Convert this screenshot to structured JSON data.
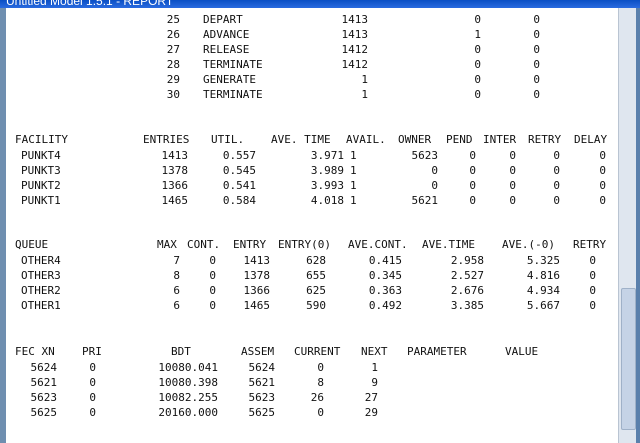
{
  "window": {
    "title": "Untitled Model 1.5.1 - REPORT"
  },
  "blocks": [
    {
      "no": "25",
      "type": "DEPART",
      "entry": "1413",
      "current": "0",
      "retry": "0"
    },
    {
      "no": "26",
      "type": "ADVANCE",
      "entry": "1413",
      "current": "1",
      "retry": "0"
    },
    {
      "no": "27",
      "type": "RELEASE",
      "entry": "1412",
      "current": "0",
      "retry": "0"
    },
    {
      "no": "28",
      "type": "TERMINATE",
      "entry": "1412",
      "current": "0",
      "retry": "0"
    },
    {
      "no": "29",
      "type": "GENERATE",
      "entry": "1",
      "current": "0",
      "retry": "0"
    },
    {
      "no": "30",
      "type": "TERMINATE",
      "entry": "1",
      "current": "0",
      "retry": "0"
    }
  ],
  "facility": {
    "headers": [
      "FACILITY",
      "ENTRIES",
      "UTIL.",
      "AVE. TIME",
      "AVAIL.",
      "OWNER",
      "PEND",
      "INTER",
      "RETRY",
      "DELAY"
    ],
    "rows": [
      [
        "PUNKT4",
        "1413",
        "0.557",
        "3.971",
        "1",
        "5623",
        "0",
        "0",
        "0",
        "0"
      ],
      [
        "PUNKT3",
        "1378",
        "0.545",
        "3.989",
        "1",
        "0",
        "0",
        "0",
        "0",
        "0"
      ],
      [
        "PUNKT2",
        "1366",
        "0.541",
        "3.993",
        "1",
        "0",
        "0",
        "0",
        "0",
        "0"
      ],
      [
        "PUNKT1",
        "1465",
        "0.584",
        "4.018",
        "1",
        "5621",
        "0",
        "0",
        "0",
        "0"
      ]
    ]
  },
  "queue": {
    "headers": [
      "QUEUE",
      "MAX",
      "CONT.",
      "ENTRY",
      "ENTRY(0)",
      "AVE.CONT.",
      "AVE.TIME",
      "AVE.(-0)",
      "RETRY"
    ],
    "rows": [
      [
        "OTHER4",
        "7",
        "0",
        "1413",
        "628",
        "0.415",
        "2.958",
        "5.325",
        "0"
      ],
      [
        "OTHER3",
        "8",
        "0",
        "1378",
        "655",
        "0.345",
        "2.527",
        "4.816",
        "0"
      ],
      [
        "OTHER2",
        "6",
        "0",
        "1366",
        "625",
        "0.363",
        "2.676",
        "4.934",
        "0"
      ],
      [
        "OTHER1",
        "6",
        "0",
        "1465",
        "590",
        "0.492",
        "3.385",
        "5.667",
        "0"
      ]
    ]
  },
  "fec": {
    "headers": [
      "FEC XN",
      "PRI",
      "BDT",
      "ASSEM",
      "CURRENT",
      "NEXT",
      "PARAMETER",
      "VALUE"
    ],
    "rows": [
      [
        "5624",
        "0",
        "10080.041",
        "5624",
        "0",
        "1"
      ],
      [
        "5621",
        "0",
        "10080.398",
        "5621",
        "8",
        "9"
      ],
      [
        "5623",
        "0",
        "10082.255",
        "5623",
        "26",
        "27"
      ],
      [
        "5625",
        "0",
        "20160.000",
        "5625",
        "0",
        "29"
      ]
    ]
  }
}
